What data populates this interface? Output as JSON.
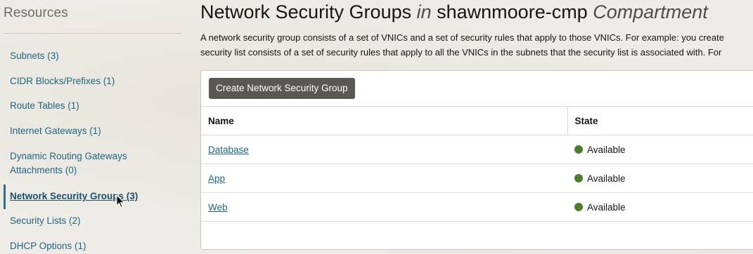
{
  "sidebar": {
    "title": "Resources",
    "items": [
      {
        "label": "Subnets (3)"
      },
      {
        "label": "CIDR Blocks/Prefixes (1)"
      },
      {
        "label": "Route Tables (1)"
      },
      {
        "label": "Internet Gateways (1)"
      },
      {
        "label": "Dynamic Routing Gateways"
      },
      {
        "label": "Attachments (0)"
      },
      {
        "label": "Network Security Groups (3)",
        "active": true
      },
      {
        "label": "Security Lists (2)"
      },
      {
        "label": "DHCP Options (1)"
      }
    ]
  },
  "header": {
    "title_part1": "Network Security Groups ",
    "title_in": "in",
    "title_part2": " shawnmoore-cmp ",
    "title_compartment": "Compartment"
  },
  "description": {
    "line1": "A network security group consists of a set of VNICs and a set of security rules that apply to those VNICs. For example: you create",
    "line2": "security list consists of a set of security rules that apply to all the VNICs in the subnets that the security list is associated with. For"
  },
  "toolbar": {
    "create_label": "Create Network Security Group"
  },
  "table": {
    "columns": [
      "Name",
      "State"
    ],
    "rows": [
      {
        "name": "Database",
        "state": "Available"
      },
      {
        "name": "App",
        "state": "Available"
      },
      {
        "name": "Web",
        "state": "Available"
      }
    ]
  },
  "colors": {
    "link": "#1f6683",
    "available": "#4c7d2b",
    "button": "#5b5753"
  }
}
